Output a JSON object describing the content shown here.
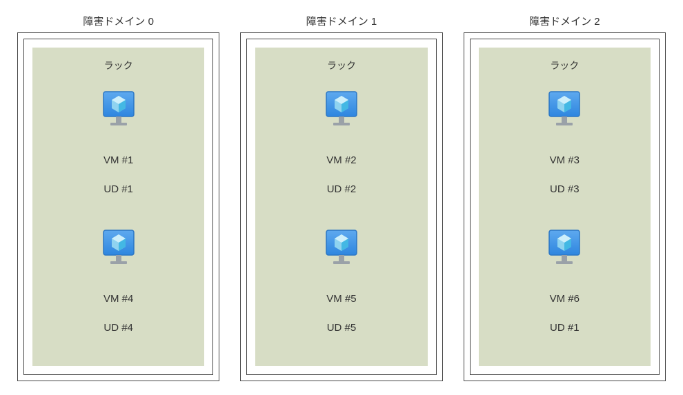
{
  "domains": [
    {
      "title": "障害ドメイン 0",
      "rack_label": "ラック",
      "vms": [
        {
          "vm_line": "VM #1",
          "ud_line": "UD #1"
        },
        {
          "vm_line": "VM #4",
          "ud_line": "UD #4"
        }
      ]
    },
    {
      "title": "障害ドメイン 1",
      "rack_label": "ラック",
      "vms": [
        {
          "vm_line": "VM #2",
          "ud_line": "UD #2"
        },
        {
          "vm_line": "VM #5",
          "ud_line": "UD #5"
        }
      ]
    },
    {
      "title": "障害ドメイン 2",
      "rack_label": "ラック",
      "vms": [
        {
          "vm_line": "VM #3",
          "ud_line": "UD #3"
        },
        {
          "vm_line": "VM #6",
          "ud_line": "UD #1"
        }
      ]
    }
  ],
  "colors": {
    "rack_bg": "#d7ddc5",
    "monitor_fill": "#3f94e6",
    "monitor_border": "#2b76c4",
    "cube_top": "#cdeffb",
    "cube_left": "#8fd3f0",
    "cube_right": "#43b8e4"
  }
}
